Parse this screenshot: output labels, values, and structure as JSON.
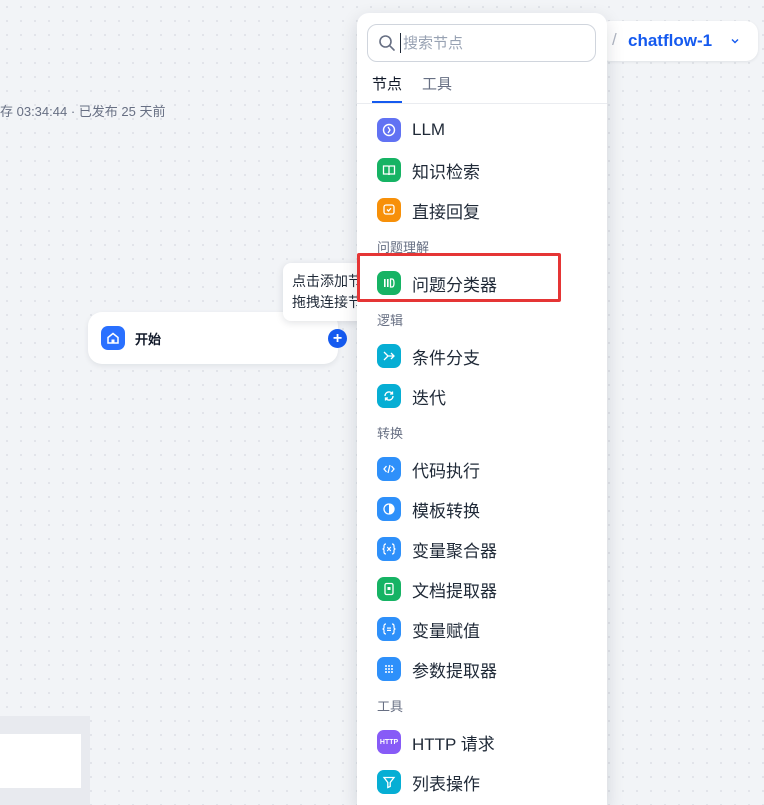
{
  "header": {
    "save_status": "存 03:34:44 · 已发布 25 天前",
    "breadcrumb_separator": "/",
    "app_title": "chatflow-1"
  },
  "canvas": {
    "start_node_label": "开始",
    "add_handle_symbol": "+",
    "tooltip_line1": "点击添加节点",
    "tooltip_line2": "拖拽连接节点"
  },
  "node_picker": {
    "search_placeholder": "搜索节点",
    "tabs": [
      "节点",
      "工具"
    ],
    "items": [
      {
        "label": "LLM",
        "icon": "llm-icon",
        "color": "#6172f3"
      },
      {
        "label": "知识检索",
        "icon": "book-icon",
        "color": "#16b364"
      },
      {
        "label": "直接回复",
        "icon": "answer-icon",
        "color": "#f79009"
      },
      {
        "group": "问题理解"
      },
      {
        "label": "问题分类器",
        "icon": "classifier-icon",
        "color": "#16b364"
      },
      {
        "group": "逻辑"
      },
      {
        "label": "条件分支",
        "icon": "branch-icon",
        "color": "#06aed4"
      },
      {
        "label": "迭代",
        "icon": "loop-icon",
        "color": "#06aed4"
      },
      {
        "group": "转换"
      },
      {
        "label": "代码执行",
        "icon": "code-icon",
        "color": "#2e90fa"
      },
      {
        "label": "模板转换",
        "icon": "template-icon",
        "color": "#2e90fa"
      },
      {
        "label": "变量聚合器",
        "icon": "variable-x-icon",
        "color": "#2e90fa"
      },
      {
        "label": "文档提取器",
        "icon": "document-icon",
        "color": "#16b364"
      },
      {
        "label": "变量赋值",
        "icon": "assign-icon",
        "color": "#2e90fa"
      },
      {
        "label": "参数提取器",
        "icon": "grid-icon",
        "color": "#2e90fa"
      },
      {
        "group": "工具"
      },
      {
        "label": "HTTP 请求",
        "icon": "http-icon",
        "color": "#875bf7",
        "badge": "HTTP"
      },
      {
        "label": "列表操作",
        "icon": "filter-icon",
        "color": "#06aed4"
      }
    ]
  },
  "highlight": {
    "color": "#e53535"
  }
}
